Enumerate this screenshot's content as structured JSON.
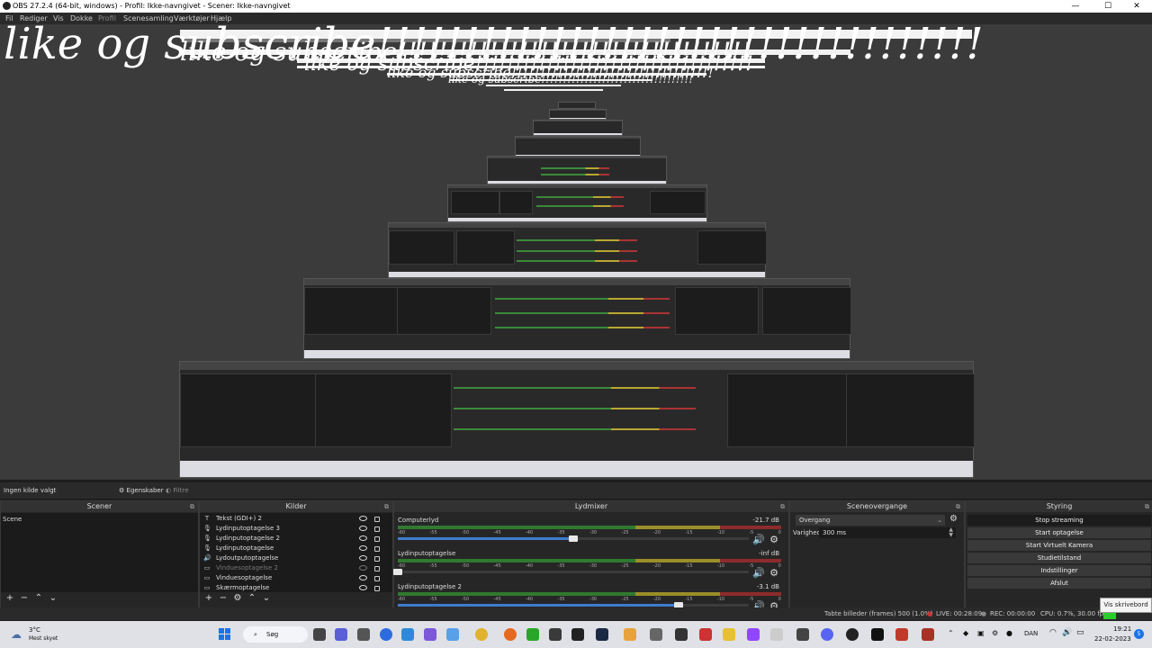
{
  "window": {
    "title": "OBS 27.2.4 (64-bit, windows) - Profil: Ikke-navngivet - Scener: Ikke-navngivet",
    "minimize": "—",
    "maximize": "☐",
    "close": "✕"
  },
  "menu": [
    "Fil",
    "Rediger",
    "Vis",
    "Dokke",
    "Profil",
    "Scenesamling",
    "Værktøjer",
    "Hjælp"
  ],
  "overlay": {
    "scribble_text": "like og subscribe!!!!!!!!!!!!!!!!!!!!!!!!!!!!!!!!!!!"
  },
  "status_row": {
    "no_source": "Ingen kilde valgt",
    "properties": "Egenskaber",
    "filters": "Filtre"
  },
  "scenes": {
    "header": "Scener",
    "items": [
      "Scene"
    ]
  },
  "sources": {
    "header": "Kilder",
    "items": [
      {
        "icon": "text-icon",
        "glyph": "T",
        "label": "Tekst (GDI+) 2"
      },
      {
        "icon": "microphone-icon",
        "glyph": "🎙",
        "label": "Lydinputoptagelse 3"
      },
      {
        "icon": "microphone-icon",
        "glyph": "🎙",
        "label": "Lydinputoptagelse 2"
      },
      {
        "icon": "microphone-icon",
        "glyph": "🎙",
        "label": "Lydinputoptagelse"
      },
      {
        "icon": "speaker-icon",
        "glyph": "🔊",
        "label": "Lydoutputoptagelse"
      },
      {
        "icon": "window-icon",
        "glyph": "▭",
        "label": "Vinduesoptagelse 2"
      },
      {
        "icon": "window-icon",
        "glyph": "▭",
        "label": "Vinduesoptagelse"
      },
      {
        "icon": "monitor-icon",
        "glyph": "▭",
        "label": "Skærmoptagelse"
      }
    ]
  },
  "mixer": {
    "header": "Lydmixer",
    "scale": [
      "-60",
      "-55",
      "-50",
      "-45",
      "-40",
      "-35",
      "-30",
      "-25",
      "-20",
      "-15",
      "-10",
      "-5",
      "0"
    ],
    "channels": [
      {
        "name": "Computerlyd",
        "db": "-21.7 dB",
        "level": 0.5
      },
      {
        "name": "Lydinputoptagelse",
        "db": "-inf dB",
        "level": 0.0
      },
      {
        "name": "Lydinputoptagelse 2",
        "db": "-3.1 dB",
        "level": 0.8
      }
    ]
  },
  "transitions": {
    "header": "Sceneovergange",
    "selected": "Overgang",
    "duration_label": "Varighed",
    "duration_value": "300 ms"
  },
  "controls": {
    "header": "Styring",
    "buttons": [
      "Stop streaming",
      "Start optagelse",
      "Start Virtuelt Kamera",
      "Studietilstand",
      "Indstillinger",
      "Afslut"
    ]
  },
  "statusbar": {
    "dropped": "Tabte billeder (frames) 500 (1.0%)",
    "live": "LIVE: 00:28:09",
    "rec": "REC: 00:00:00",
    "cpu": "CPU: 0.7%, 30.00 fps"
  },
  "tooltip": "Vis skrivebord",
  "taskbar": {
    "weather_temp": "3°C",
    "weather_desc": "Mest skyet",
    "search": "Søg",
    "language": "DAN",
    "time": "19:21",
    "date": "22-02-2023",
    "notification_count": "5"
  },
  "colors": {
    "accent_blue": "#3f7bd0",
    "meter_green": "#2f7a2f",
    "meter_yellow": "#9a8f28",
    "meter_red": "#8e2b2b",
    "stream_indicator": "#2dcc2d"
  }
}
